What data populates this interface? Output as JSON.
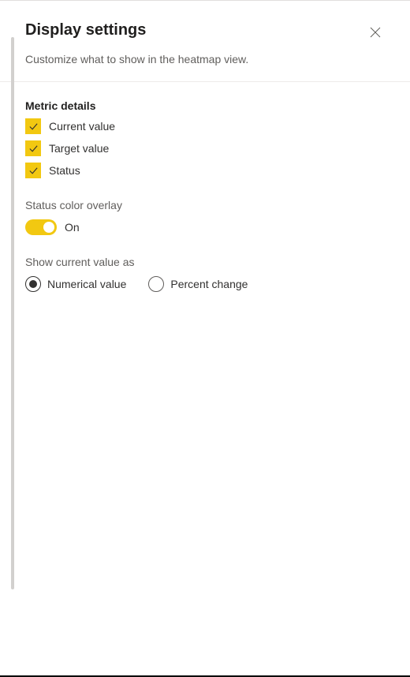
{
  "panel": {
    "title": "Display settings",
    "subtitle": "Customize what to show in the heatmap view."
  },
  "metric_details": {
    "label": "Metric details",
    "options": [
      {
        "label": "Current value",
        "checked": true
      },
      {
        "label": "Target value",
        "checked": true
      },
      {
        "label": "Status",
        "checked": true
      }
    ]
  },
  "status_overlay": {
    "label": "Status color overlay",
    "state_label": "On",
    "on": true
  },
  "show_as": {
    "label": "Show current value as",
    "options": [
      {
        "label": "Numerical value",
        "selected": true
      },
      {
        "label": "Percent change",
        "selected": false
      }
    ]
  },
  "colors": {
    "accent": "#f2c811"
  }
}
